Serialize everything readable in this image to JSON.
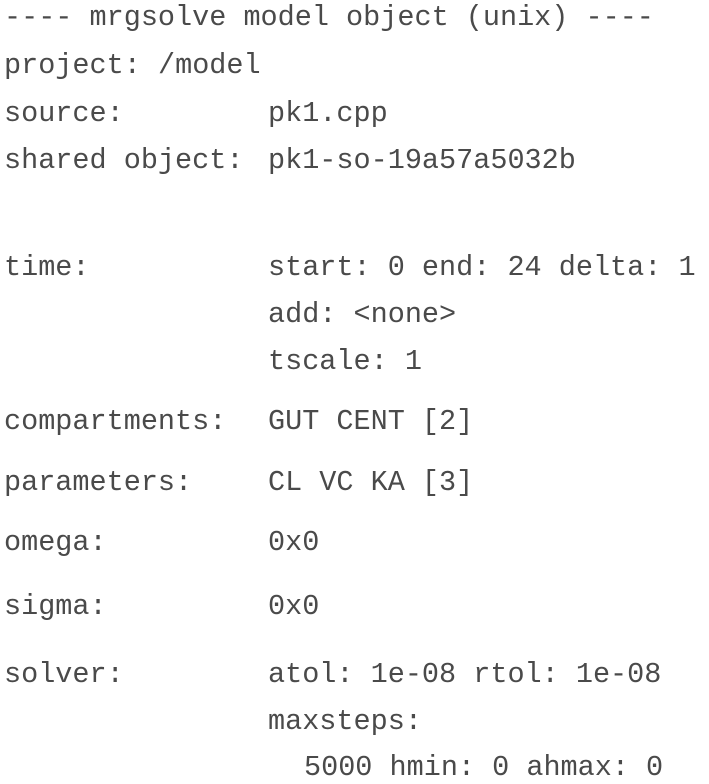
{
  "header": "---- mrgsolve model object (unix) ----",
  "project": {
    "label": "project:",
    "value": "/model"
  },
  "source": {
    "label": "source:",
    "value": "pk1.cpp"
  },
  "shared_object": {
    "label": "shared object:",
    "value": "pk1-so-19a57a5032b"
  },
  "time": {
    "label": "time:",
    "lines": [
      "start: 0 end: 24 delta: 1",
      "add: <none>",
      "tscale: 1"
    ]
  },
  "compartments": {
    "label": "compartments:",
    "value": "GUT CENT [2]"
  },
  "parameters": {
    "label": "parameters:",
    "value": "CL VC KA [3]"
  },
  "omega": {
    "label": "omega:",
    "value": "0x0"
  },
  "sigma": {
    "label": "sigma:",
    "value": "0x0"
  },
  "solver": {
    "label": "solver:",
    "lines": [
      "atol: 1e-08 rtol: 1e-08",
      "maxsteps:",
      "5000 hmin: 0 ahmax: 0"
    ]
  }
}
